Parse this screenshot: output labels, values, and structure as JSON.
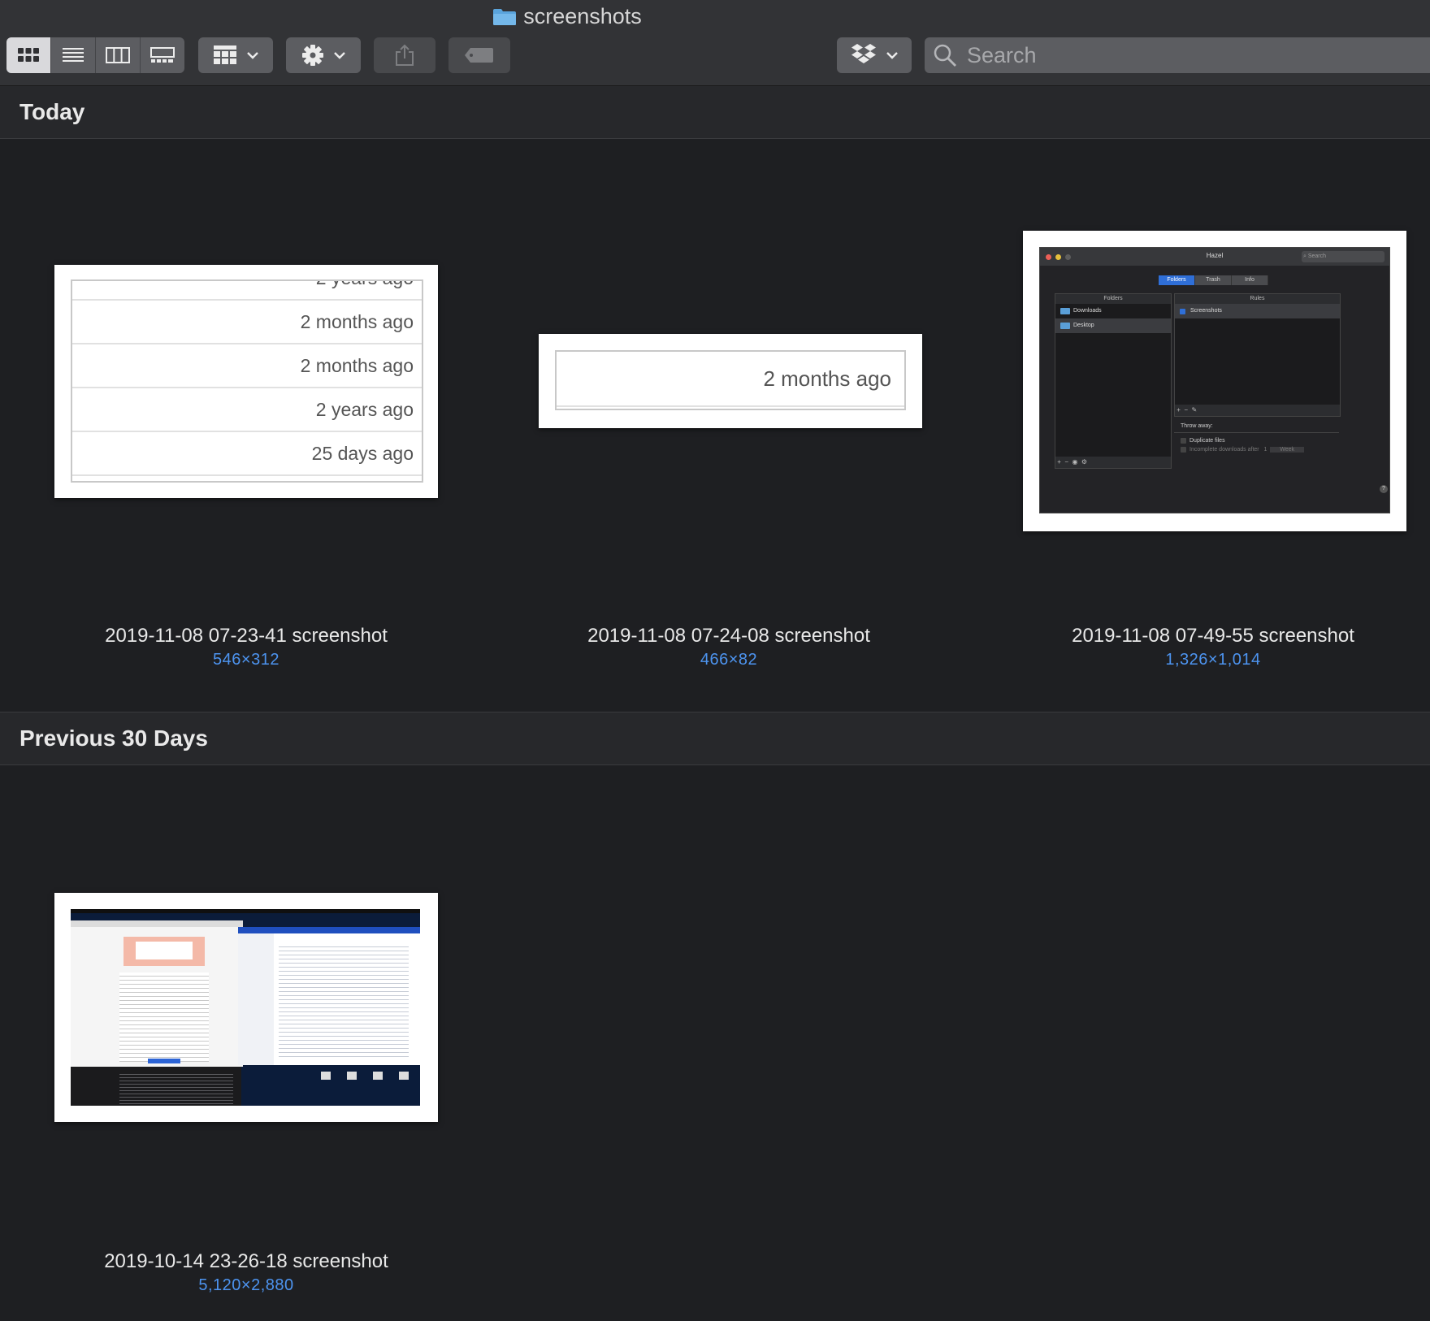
{
  "window": {
    "title": "screenshots",
    "folder_color": "#5aa4dc"
  },
  "toolbar": {
    "view_modes": [
      "icon-view-icon",
      "list-view-icon",
      "column-view-icon",
      "gallery-view-icon"
    ],
    "active_view": "icon-view-icon",
    "group_icon": "grid-group-icon",
    "action_icon": "gear-icon",
    "share_icon": "share-icon",
    "tag_icon": "tag-icon",
    "dropbox_icon": "dropbox-icon",
    "search_placeholder": "Search"
  },
  "colors": {
    "background": "#1e1f22",
    "toolbar": "#323336",
    "section_header": "#27282b",
    "dimension_text": "#4d94f0"
  },
  "sections": [
    {
      "title": "Today",
      "items": [
        {
          "name": "2019-11-08 07-23-41 screenshot",
          "dimensions": "546×312",
          "thumb_rows": [
            "2 years ago",
            "2 months ago",
            "2 months ago",
            "2 years ago",
            "25 days ago"
          ]
        },
        {
          "name": "2019-11-08 07-24-08 screenshot",
          "dimensions": "466×82",
          "thumb_rows": [
            "2 months ago"
          ]
        },
        {
          "name": "2019-11-08 07-49-55 screenshot",
          "dimensions": "1,326×1,014",
          "thumb_app": {
            "title": "Hazel",
            "search": "Search",
            "tabs": [
              "Folders",
              "Trash",
              "Info"
            ],
            "folders_header": "Folders",
            "folders": [
              "Downloads",
              "Desktop"
            ],
            "rules_header": "Rules",
            "rules": [
              "Screenshots"
            ],
            "throw_away_label": "Throw away:",
            "duplicate_files": "Duplicate files",
            "incomplete_downloads": "Incomplete downloads after",
            "incomplete_value": "1",
            "incomplete_unit": "Week"
          }
        }
      ]
    },
    {
      "title": "Previous 30 Days",
      "items": [
        {
          "name": "2019-10-14 23-26-18 screenshot",
          "dimensions": "5,120×2,880"
        }
      ]
    }
  ]
}
